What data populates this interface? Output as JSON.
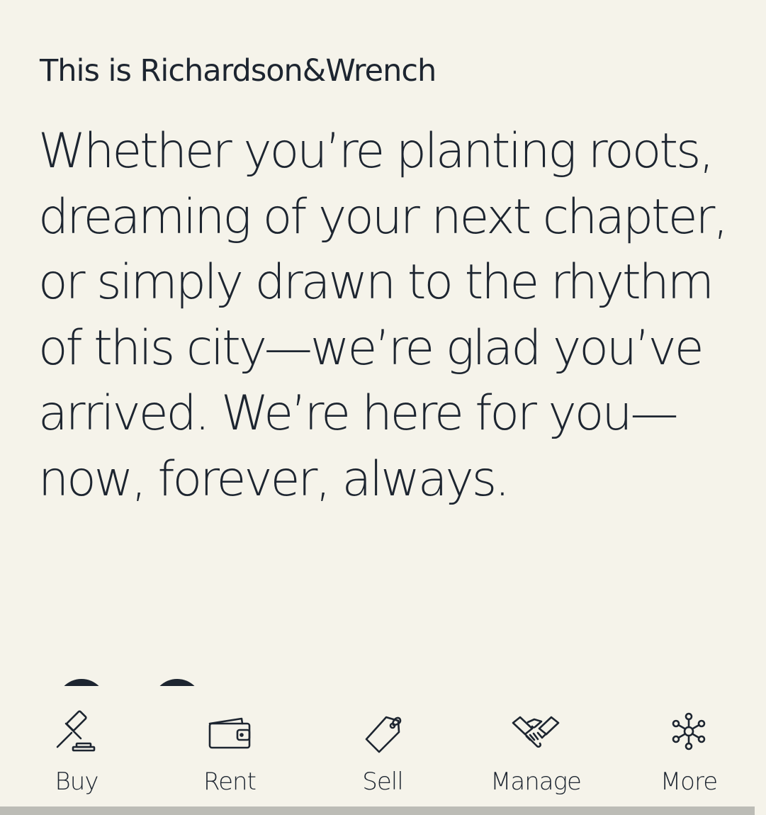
{
  "intro": {
    "eyebrow": "This is Richardson&Wrench",
    "headline_lines": [
      "Whether you’re planting roots,",
      "dreaming of your next chapter,",
      "or simply drawn to the rhythm",
      "of this city—we’re glad you’ve",
      "arrived. We’re here for you—",
      "now, forever, always."
    ]
  },
  "bottom_nav": {
    "items": [
      {
        "label": "Buy",
        "icon": "gavel-icon"
      },
      {
        "label": "Rent",
        "icon": "wallet-icon"
      },
      {
        "label": "Sell",
        "icon": "price-tag-icon"
      },
      {
        "label": "Manage",
        "icon": "handshake-icon"
      },
      {
        "label": "More",
        "icon": "network-icon"
      }
    ]
  },
  "colors": {
    "background": "#f5f3ea",
    "text": "#1d2530",
    "scrollbar": "#bcbcb6"
  }
}
